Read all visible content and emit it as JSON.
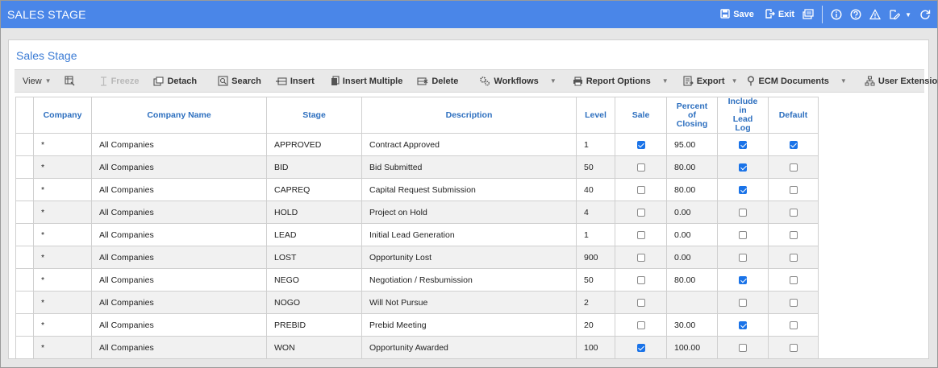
{
  "app": {
    "title": "SALES STAGE",
    "save_label": "Save",
    "exit_label": "Exit"
  },
  "panel": {
    "title": "Sales Stage"
  },
  "toolbar": {
    "view": "View",
    "freeze": "Freeze",
    "detach": "Detach",
    "search": "Search",
    "insert": "Insert",
    "insert_multiple": "Insert Multiple",
    "delete": "Delete",
    "workflows": "Workflows",
    "report_options": "Report Options",
    "export": "Export",
    "ecm_documents": "ECM Documents",
    "user_extensions": "User Extensions"
  },
  "columns": {
    "company": "Company",
    "company_name": "Company Name",
    "stage": "Stage",
    "description": "Description",
    "level": "Level",
    "sale": "Sale",
    "percent_closing_1": "Percent of",
    "percent_closing_2": "Closing",
    "lead_log_1": "Include in",
    "lead_log_2": "Lead Log",
    "default": "Default"
  },
  "rows": [
    {
      "company": "*",
      "company_name": "All Companies",
      "stage": "APPROVED",
      "description": "Contract Approved",
      "level": "1",
      "sale": true,
      "percent": "95.00",
      "lead_log": true,
      "default": true
    },
    {
      "company": "*",
      "company_name": "All Companies",
      "stage": "BID",
      "description": "Bid Submitted",
      "level": "50",
      "sale": false,
      "percent": "80.00",
      "lead_log": true,
      "default": false
    },
    {
      "company": "*",
      "company_name": "All Companies",
      "stage": "CAPREQ",
      "description": "Capital Request Submission",
      "level": "40",
      "sale": false,
      "percent": "80.00",
      "lead_log": true,
      "default": false
    },
    {
      "company": "*",
      "company_name": "All Companies",
      "stage": "HOLD",
      "description": "Project on Hold",
      "level": "4",
      "sale": false,
      "percent": "0.00",
      "lead_log": false,
      "default": false
    },
    {
      "company": "*",
      "company_name": "All Companies",
      "stage": "LEAD",
      "description": "Initial Lead Generation",
      "level": "1",
      "sale": false,
      "percent": "0.00",
      "lead_log": false,
      "default": false
    },
    {
      "company": "*",
      "company_name": "All Companies",
      "stage": "LOST",
      "description": "Opportunity Lost",
      "level": "900",
      "sale": false,
      "percent": "0.00",
      "lead_log": false,
      "default": false
    },
    {
      "company": "*",
      "company_name": "All Companies",
      "stage": "NEGO",
      "description": "Negotiation / Resbumission",
      "level": "50",
      "sale": false,
      "percent": "80.00",
      "lead_log": true,
      "default": false
    },
    {
      "company": "*",
      "company_name": "All Companies",
      "stage": "NOGO",
      "description": "Will Not Pursue",
      "level": "2",
      "sale": false,
      "percent": "",
      "lead_log": false,
      "default": false
    },
    {
      "company": "*",
      "company_name": "All Companies",
      "stage": "PREBID",
      "description": "Prebid Meeting",
      "level": "20",
      "sale": false,
      "percent": "30.00",
      "lead_log": true,
      "default": false
    },
    {
      "company": "*",
      "company_name": "All Companies",
      "stage": "WON",
      "description": "Opportunity Awarded",
      "level": "100",
      "sale": true,
      "percent": "100.00",
      "lead_log": false,
      "default": false
    }
  ],
  "colors": {
    "titlebar": "#4a86e8",
    "header_text": "#2d6fbf",
    "checkbox_on": "#1a73e8"
  }
}
